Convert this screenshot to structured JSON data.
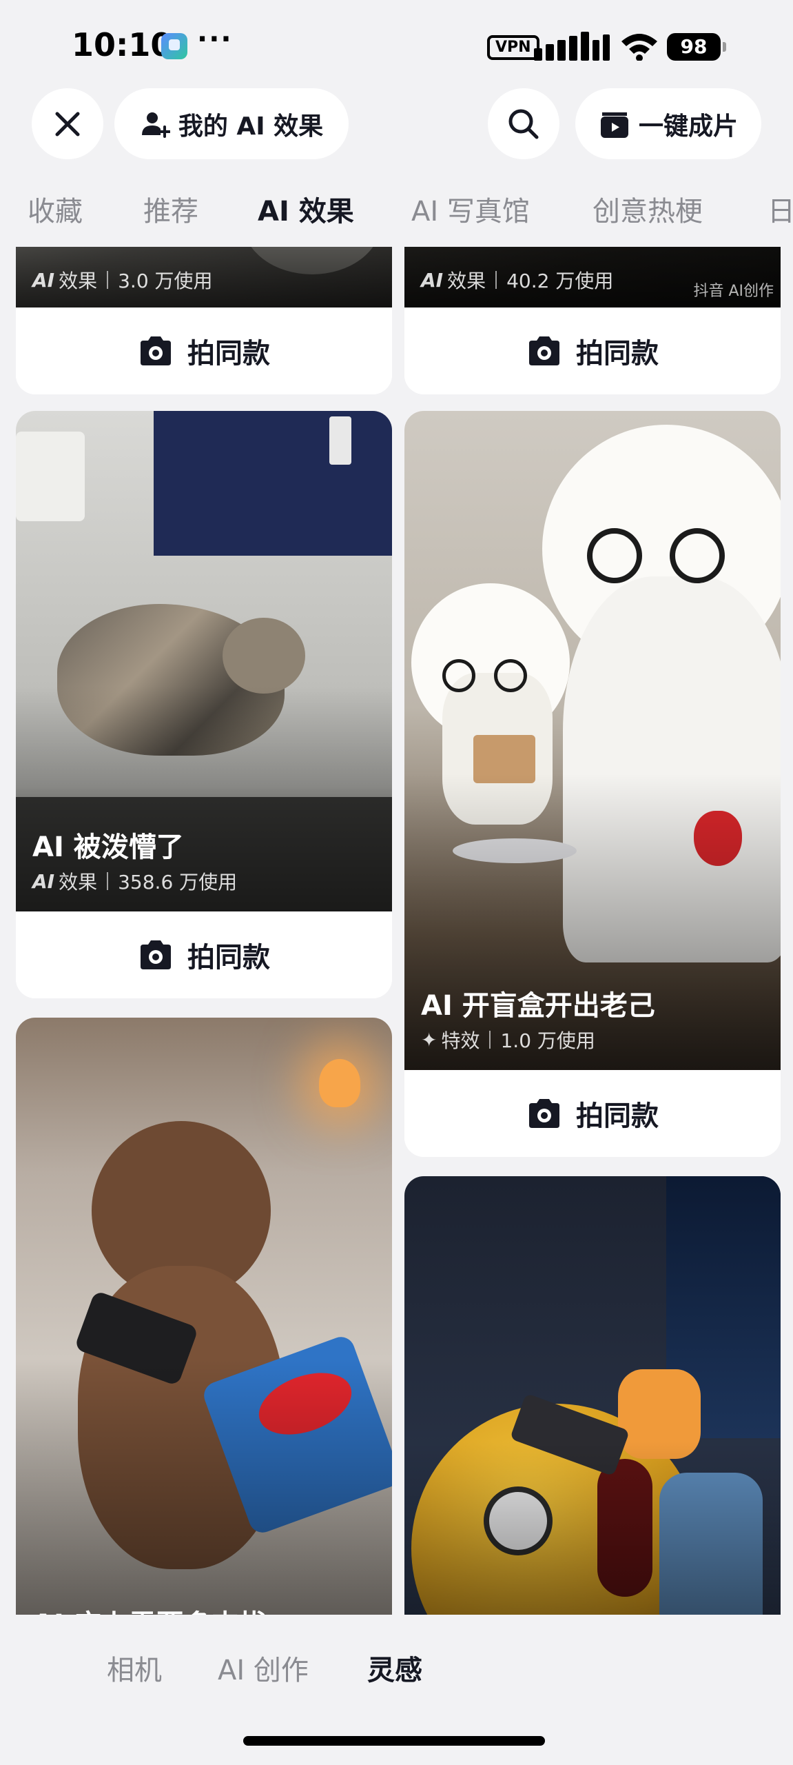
{
  "status_bar": {
    "time": "10:10",
    "dots": "···",
    "vpn": "VPN",
    "battery": "98"
  },
  "top_bar": {
    "my_ai_label": "我的 AI 效果",
    "one_click_label": "一键成片"
  },
  "category_tabs": [
    {
      "label": "收藏",
      "active": false
    },
    {
      "label": "推荐",
      "active": false
    },
    {
      "label": "AI 效果",
      "active": true
    },
    {
      "label": "AI 写真馆",
      "active": false
    },
    {
      "label": "创意热梗",
      "active": false
    },
    {
      "label": "日",
      "active": false
    }
  ],
  "cards": [
    {
      "title": "",
      "tag": "AI",
      "type": "效果",
      "uses": "3.0 万使用",
      "button": "拍同款"
    },
    {
      "title": "",
      "tag": "AI",
      "type": "效果",
      "uses": "40.2 万使用",
      "button": "拍同款",
      "watermark": "抖音 AI创作"
    },
    {
      "title": "AI 被泼懵了",
      "tag": "AI",
      "type": "效果",
      "uses": "358.6 万使用",
      "button": "拍同款"
    },
    {
      "title": "AI 开盲盒开出老己",
      "tag": "✦",
      "type": "特效",
      "uses": "1.0 万使用",
      "button": "拍同款"
    },
    {
      "title": "AI 床上需要多支拔",
      "tag": "",
      "type": "",
      "uses": "",
      "button": ""
    },
    {
      "title": "",
      "tag": "",
      "type": "",
      "uses": "",
      "button": ""
    }
  ],
  "bottom_nav": [
    {
      "label": "相机",
      "active": false
    },
    {
      "label": "AI 创作",
      "active": false
    },
    {
      "label": "灵感",
      "active": true
    }
  ],
  "colors": {
    "background": "#f2f2f4",
    "text_primary": "#161823",
    "text_secondary": "#8a8b91"
  }
}
